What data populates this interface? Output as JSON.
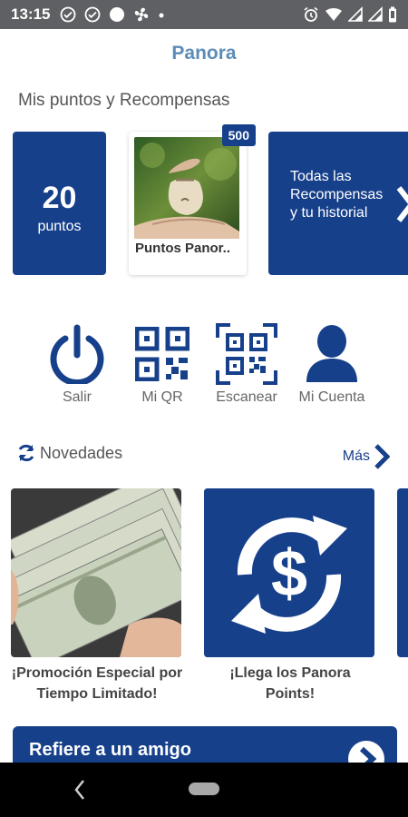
{
  "status_bar": {
    "time": "13:15",
    "icons_left": [
      "check-circle-icon",
      "check-circle-icon",
      "circle-icon",
      "fan-icon",
      "dot-icon"
    ],
    "icons_right": [
      "alarm-icon",
      "wifi-icon",
      "signal-icon",
      "signal-icon",
      "battery-icon"
    ]
  },
  "header": {
    "title": "Panora"
  },
  "rewards_section": {
    "title": "Mis puntos y Recompensas",
    "points_card": {
      "value": "20",
      "unit": "puntos"
    },
    "reward_card": {
      "badge": "500",
      "label": "Puntos Panor.."
    },
    "all_rewards_card": {
      "label": "Todas las Recompensas y tu historial"
    }
  },
  "actions": [
    {
      "label": "Salir",
      "icon": "power-icon"
    },
    {
      "label": "Mi QR",
      "icon": "qr-code-icon"
    },
    {
      "label": "Escanear",
      "icon": "qr-scan-icon"
    },
    {
      "label": "Mi Cuenta",
      "icon": "user-icon"
    }
  ],
  "news": {
    "title": "Novedades",
    "more": "Más",
    "items": [
      {
        "caption": "¡Promoción Especial por Tiempo Limitado!"
      },
      {
        "caption": "¡Llega los Panora Points!"
      }
    ]
  },
  "refer": {
    "label": "Refiere a un amigo"
  },
  "colors": {
    "brand": "#17408b",
    "header_title": "#5b8db8",
    "status_bar": "#5f6063"
  }
}
